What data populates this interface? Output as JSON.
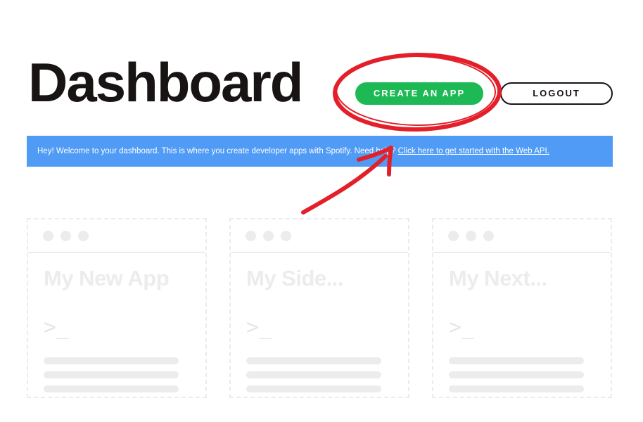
{
  "header": {
    "title": "Dashboard",
    "create_label": "CREATE AN APP",
    "logout_label": "LOGOUT"
  },
  "banner": {
    "text": "Hey! Welcome to your dashboard. This is where you create developer apps with Spotify. Need help? ",
    "link_text": "Click here to get started with the Web API."
  },
  "cards": [
    {
      "title": "My New App",
      "prompt": ">_"
    },
    {
      "title": "My Side...",
      "prompt": ">_"
    },
    {
      "title": "My Next...",
      "prompt": ">_"
    }
  ],
  "colors": {
    "accent": "#1db954",
    "banner": "#509bf5",
    "annotation": "#e3202a"
  },
  "icons": {
    "card_dots": "window-dots-icon",
    "annotation": "red-arrow-annotation"
  }
}
